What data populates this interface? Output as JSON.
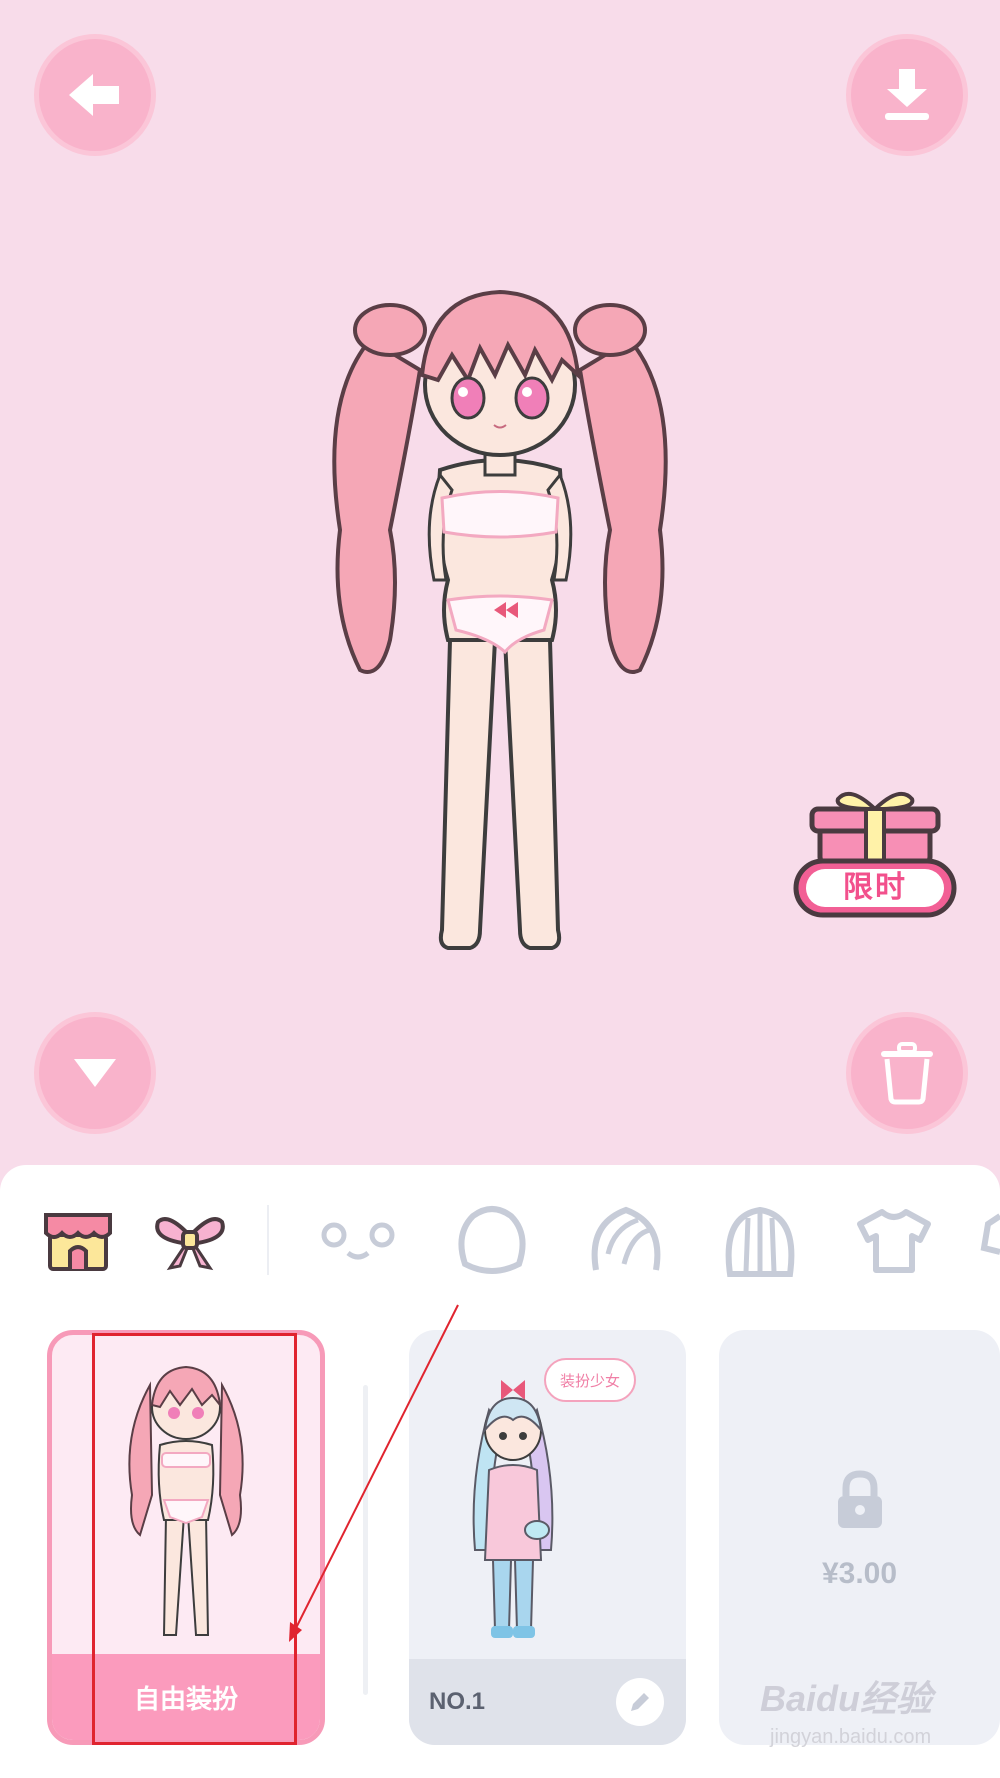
{
  "colors": {
    "stage_bg": "#f8dcea",
    "button_pink": "#f9b3cb",
    "accent_pink": "#fb9bbd",
    "icon_gray": "#c7ccd8"
  },
  "toolbar": {
    "back_icon": "back-arrow-icon",
    "download_icon": "download-icon",
    "collapse_icon": "triangle-down-icon",
    "delete_icon": "trash-icon"
  },
  "promo": {
    "label": "限时"
  },
  "categories": [
    {
      "name": "shop",
      "icon": "shop-icon"
    },
    {
      "name": "bow",
      "icon": "bow-icon"
    },
    {
      "name": "face",
      "icon": "face-icon"
    },
    {
      "name": "head",
      "icon": "head-icon"
    },
    {
      "name": "hair-front",
      "icon": "hair-front-icon"
    },
    {
      "name": "hair-back",
      "icon": "hair-back-icon"
    },
    {
      "name": "top",
      "icon": "tshirt-icon"
    }
  ],
  "cards": [
    {
      "label": "自由装扮",
      "selected": true
    },
    {
      "label": "NO.1",
      "bubble": "装扮少女",
      "edit_icon": "pencil-icon"
    },
    {
      "price": "¥3.00",
      "locked": true
    }
  ],
  "watermark": {
    "brand": "Baidu经验",
    "url": "jingyan.baidu.com"
  }
}
